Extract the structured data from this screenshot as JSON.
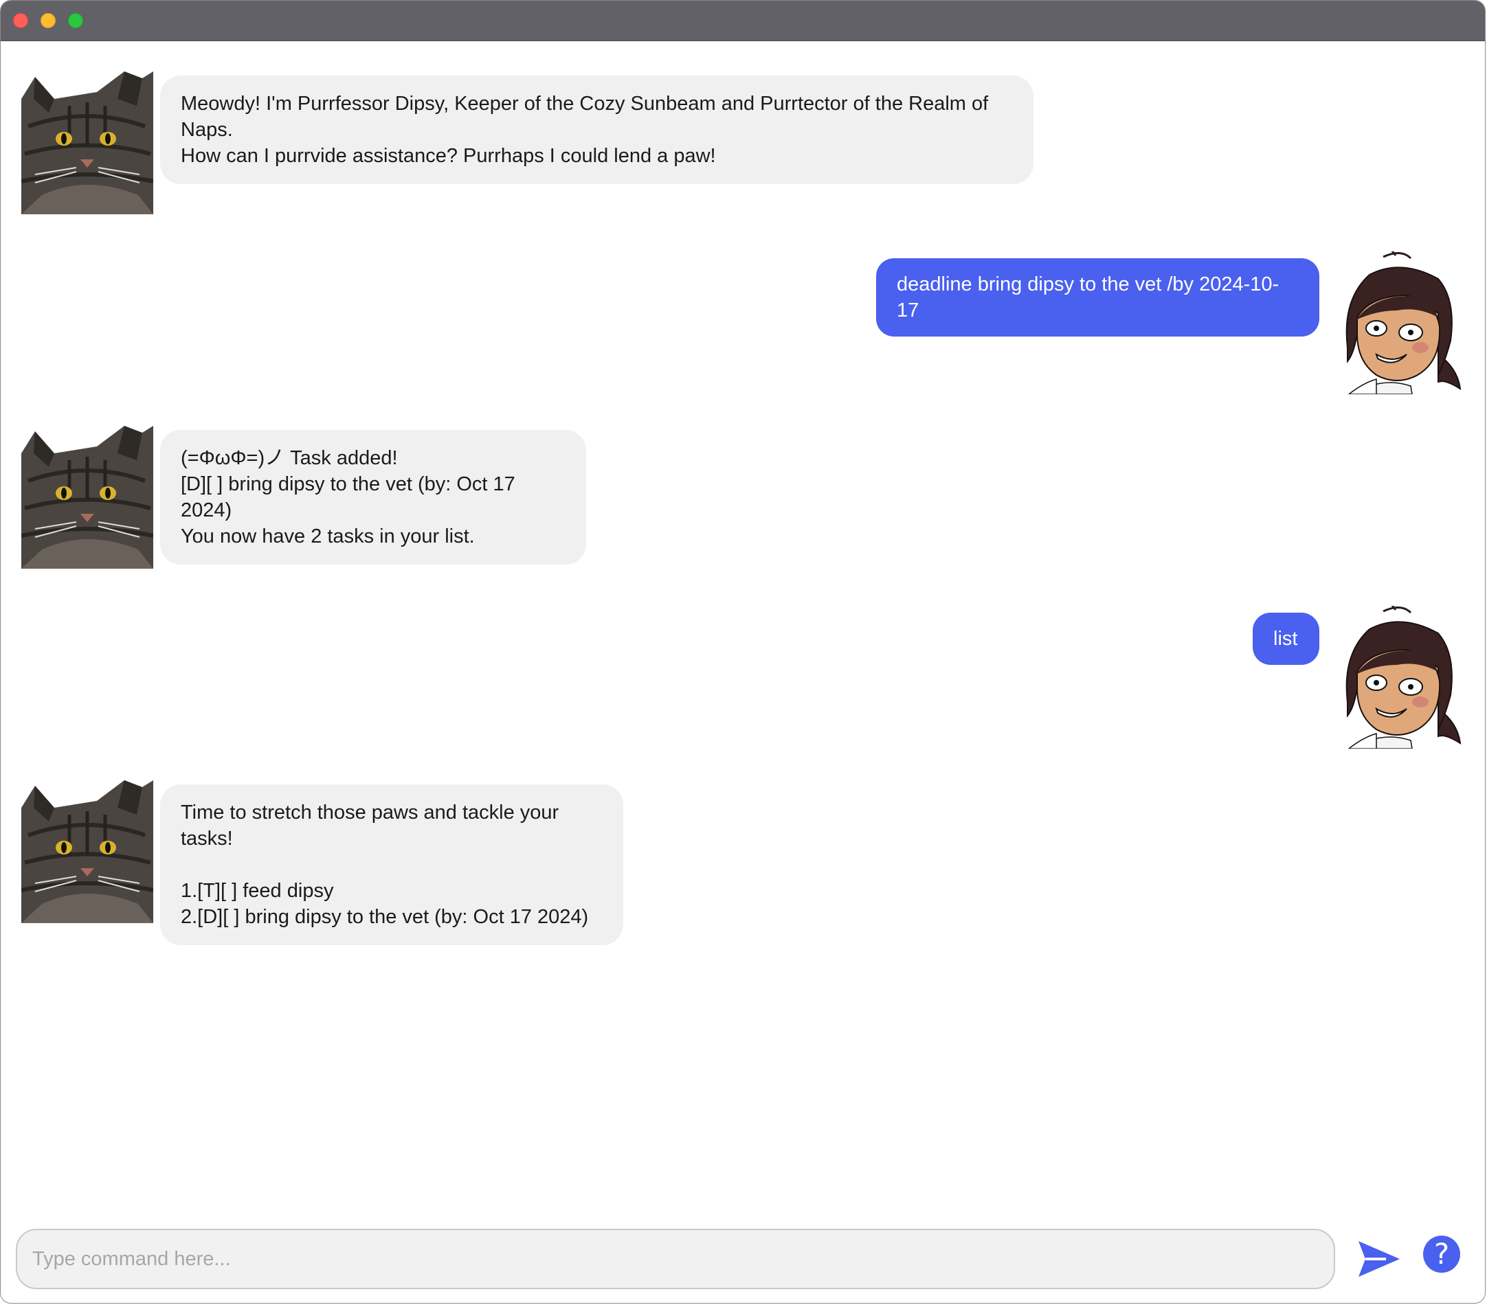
{
  "window": {
    "buttons": [
      "close",
      "minimize",
      "maximize"
    ]
  },
  "messages": [
    {
      "sender": "bot",
      "avatar": "cat-avatar",
      "text": "Meowdy! I'm Purrfessor Dipsy, Keeper of the Cozy Sunbeam and Purrtector of the Realm of Naps.\nHow can I purrvide assistance? Purrhaps I could lend a paw!"
    },
    {
      "sender": "user",
      "avatar": "user-avatar",
      "text": "deadline bring dipsy to the vet /by 2024-10-17"
    },
    {
      "sender": "bot",
      "avatar": "cat-avatar",
      "text": "(=ΦωΦ=)ノ Task added!\n[D][ ] bring dipsy to the vet (by: Oct 17 2024)\nYou now have 2 tasks in your list."
    },
    {
      "sender": "user",
      "avatar": "user-avatar",
      "text": "list"
    },
    {
      "sender": "bot",
      "avatar": "cat-avatar",
      "text": "Time to stretch those paws and tackle your tasks!\n\n1.[T][ ] feed dipsy\n2.[D][ ] bring dipsy to the vet (by: Oct 17 2024)"
    }
  ],
  "input": {
    "placeholder": "Type command here...",
    "value": ""
  },
  "send_button": {
    "icon": "send-icon"
  },
  "help_button": {
    "label": "?",
    "icon": "help-icon"
  },
  "colors": {
    "accent": "#4a60ef",
    "bot_bubble": "#f0f0f0",
    "titlebar": "#636168"
  }
}
